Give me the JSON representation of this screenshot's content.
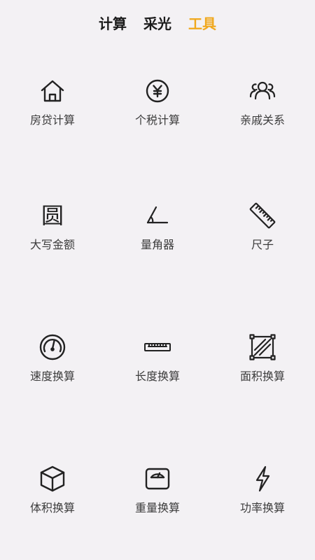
{
  "tabs": [
    {
      "label": "计算",
      "active": false
    },
    {
      "label": "采光",
      "active": false
    },
    {
      "label": "工具",
      "active": true
    }
  ],
  "colors": {
    "active_tab": "#f0a81c",
    "tab_text": "#1b1b1b",
    "background": "#f3f1f4",
    "icon_stroke": "#222222",
    "label_text": "#3c3c3c"
  },
  "tools": [
    {
      "label": "房贷计算",
      "icon": "house-icon"
    },
    {
      "label": "个税计算",
      "icon": "yen-coin-icon"
    },
    {
      "label": "亲戚关系",
      "icon": "people-group-icon"
    },
    {
      "label": "大写金额",
      "icon": "yuan-character-icon",
      "icon_text": "圆"
    },
    {
      "label": "量角器",
      "icon": "protractor-angle-icon"
    },
    {
      "label": "尺子",
      "icon": "ruler-icon"
    },
    {
      "label": "速度换算",
      "icon": "speedometer-icon"
    },
    {
      "label": "长度换算",
      "icon": "tape-measure-icon"
    },
    {
      "label": "面积换算",
      "icon": "area-square-icon"
    },
    {
      "label": "体积换算",
      "icon": "cube-icon"
    },
    {
      "label": "重量换算",
      "icon": "weighing-scale-icon"
    },
    {
      "label": "功率换算",
      "icon": "lightning-bolt-icon"
    }
  ]
}
